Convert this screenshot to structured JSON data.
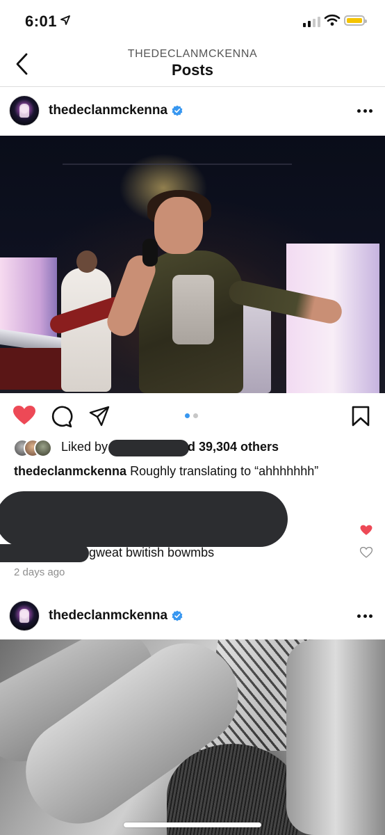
{
  "status_bar": {
    "time": "6:01",
    "battery_color": "#f5c400",
    "location_icon": "location-arrow-icon"
  },
  "nav": {
    "back_icon": "chevron-left-icon",
    "subtitle": "THEDECLANMCKENNA",
    "title": "Posts"
  },
  "posts": [
    {
      "username": "thedeclanmckenna",
      "verified_color": "#3897f0",
      "image_description_icon": "concert-photo",
      "carousel": {
        "count": 2,
        "active": 0,
        "active_color": "#3897f0",
        "inactive_color": "#c7c7c7"
      },
      "actions": {
        "liked": true,
        "like_color": "#ed4956"
      },
      "likes": {
        "prefix": "Liked by",
        "suffix": "d 39,304 others"
      },
      "caption": {
        "username": "thedeclanmckenna",
        "text": " Roughly translating to “ahhhhhhh”"
      },
      "comment_visible_text": "gweat bwitish bowmbs",
      "time_ago": "2 days ago"
    },
    {
      "username": "thedeclanmckenna",
      "verified_color": "#3897f0",
      "image_description_icon": "black-and-white-photo"
    }
  ]
}
